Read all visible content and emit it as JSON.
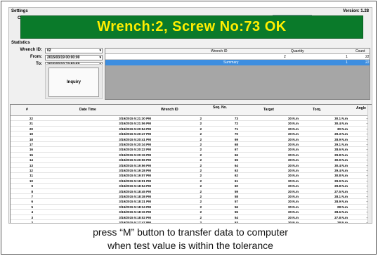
{
  "header": {
    "settings_label": "Settings",
    "settings_c": "C",
    "version": "Version: 1.28"
  },
  "banner": {
    "message": "Wrench:2, Screw No:73 OK",
    "background": "#0a7a2a",
    "text_color": "#ffee00"
  },
  "statistics": {
    "label": "Statistics",
    "wrench_id_label": "Wrench ID:",
    "wrench_id_value": "02",
    "from_label": "From:",
    "from_value": "2015/03/19 00:00:00",
    "to_label": "To:",
    "to_value": "2015/03/19 23:59:59",
    "inquiry_label": "Inquiry"
  },
  "summary_grid": {
    "columns": [
      "Wrench ID",
      "Quantity",
      "Count"
    ],
    "row": {
      "wrench_id": "2",
      "quantity": "1",
      "count": "22"
    },
    "summary_row": {
      "label": "Summary",
      "quantity": "1",
      "count": "22"
    }
  },
  "records": {
    "columns": [
      "#",
      "Date Time",
      "Wrench ID",
      "Seq. No.",
      "Target",
      "Torq.",
      "Angle"
    ],
    "rows": [
      {
        "n": "22",
        "dt": "3/19/2015 5:21:30 PM",
        "w": "2",
        "seq": "73",
        "target": "30 N.m",
        "torq": "30.1 N.m",
        "angle": "-"
      },
      {
        "n": "21",
        "dt": "3/19/2015 5:21:06 PM",
        "w": "2",
        "seq": "72",
        "target": "30 N.m",
        "torq": "30.4 N.m",
        "angle": "-"
      },
      {
        "n": "20",
        "dt": "3/19/2015 5:20:54 PM",
        "w": "2",
        "seq": "71",
        "target": "30 N.m",
        "torq": "30 N.m",
        "angle": "-"
      },
      {
        "n": "19",
        "dt": "3/19/2015 5:20:47 PM",
        "w": "2",
        "seq": "70",
        "target": "30 N.m",
        "torq": "29.3 N.m",
        "angle": "-"
      },
      {
        "n": "18",
        "dt": "3/19/2015 5:20:41 PM",
        "w": "2",
        "seq": "69",
        "target": "30 N.m",
        "torq": "28.9 N.m",
        "angle": "-"
      },
      {
        "n": "17",
        "dt": "3/19/2015 5:20:34 PM",
        "w": "2",
        "seq": "68",
        "target": "30 N.m",
        "torq": "29.1 N.m",
        "angle": "-"
      },
      {
        "n": "16",
        "dt": "3/19/2015 5:20:22 PM",
        "w": "2",
        "seq": "67",
        "target": "30 N.m",
        "torq": "28.6 N.m",
        "angle": "-"
      },
      {
        "n": "15",
        "dt": "3/19/2015 5:20:15 PM",
        "w": "2",
        "seq": "66",
        "target": "30 N.m",
        "torq": "29.8 N.m",
        "angle": "-"
      },
      {
        "n": "14",
        "dt": "3/19/2015 5:20:06 PM",
        "w": "2",
        "seq": "65",
        "target": "30 N.m",
        "torq": "30.9 N.m",
        "angle": "-"
      },
      {
        "n": "13",
        "dt": "3/19/2015 5:19:56 PM",
        "w": "2",
        "seq": "64",
        "target": "30 N.m",
        "torq": "30.4 N.m",
        "angle": "-"
      },
      {
        "n": "12",
        "dt": "3/19/2015 5:19:28 PM",
        "w": "2",
        "seq": "63",
        "target": "30 N.m",
        "torq": "29.4 N.m",
        "angle": "-"
      },
      {
        "n": "11",
        "dt": "3/19/2015 5:19:07 PM",
        "w": "2",
        "seq": "62",
        "target": "30 N.m",
        "torq": "30.8 N.m",
        "angle": "-"
      },
      {
        "n": "10",
        "dt": "3/19/2015 5:19:01 PM",
        "w": "2",
        "seq": "61",
        "target": "30 N.m",
        "torq": "29.9 N.m",
        "angle": "-"
      },
      {
        "n": "9",
        "dt": "3/19/2015 5:18:54 PM",
        "w": "2",
        "seq": "60",
        "target": "30 N.m",
        "torq": "29.8 N.m",
        "angle": "-"
      },
      {
        "n": "8",
        "dt": "3/19/2015 5:18:45 PM",
        "w": "2",
        "seq": "59",
        "target": "30 N.m",
        "torq": "27.5 N.m",
        "angle": "-"
      },
      {
        "n": "7",
        "dt": "3/19/2015 5:18:38 PM",
        "w": "2",
        "seq": "58",
        "target": "30 N.m",
        "torq": "28.1 N.m",
        "angle": "-"
      },
      {
        "n": "6",
        "dt": "3/19/2015 5:18:31 PM",
        "w": "2",
        "seq": "57",
        "target": "30 N.m",
        "torq": "28.9 N.m",
        "angle": "-"
      },
      {
        "n": "5",
        "dt": "3/19/2015 5:18:24 PM",
        "w": "2",
        "seq": "56",
        "target": "30 N.m",
        "torq": "28 N.m",
        "angle": "-"
      },
      {
        "n": "4",
        "dt": "3/19/2015 5:18:15 PM",
        "w": "2",
        "seq": "55",
        "target": "30 N.m",
        "torq": "28.6 N.m",
        "angle": "-"
      },
      {
        "n": "3",
        "dt": "3/19/2015 5:18:02 PM",
        "w": "2",
        "seq": "54",
        "target": "30 N.m",
        "torq": "27.8 N.m",
        "angle": "-"
      },
      {
        "n": "2",
        "dt": "3/19/2015 5:17:47 PM",
        "w": "2",
        "seq": "53",
        "target": "30 N.m",
        "torq": "28 N.m",
        "angle": "-"
      }
    ]
  },
  "caption": {
    "line1": "press “M” button to transfer data to computer",
    "line2": "when test value is within the tolerance"
  }
}
